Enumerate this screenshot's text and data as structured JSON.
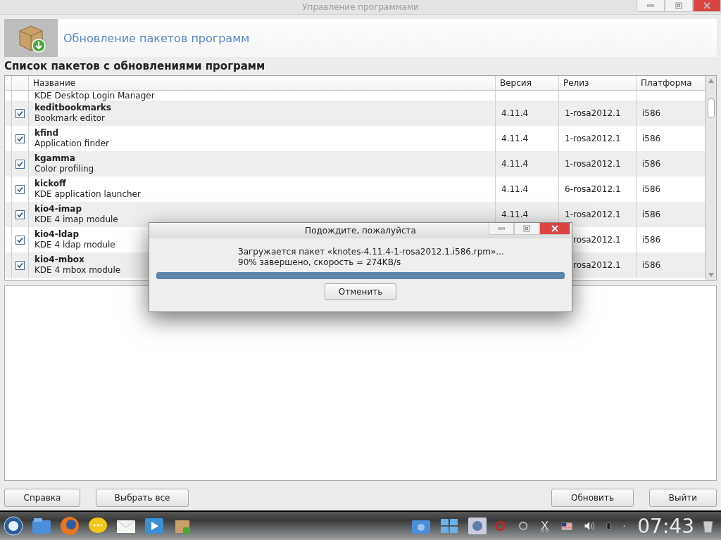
{
  "window": {
    "title": "Управление программами"
  },
  "header": {
    "title": "Обновление пакетов программ"
  },
  "section_title": "Список пакетов с обновлениями программ",
  "table": {
    "columns": [
      "Название",
      "Версия",
      "Релиз",
      "Платформа"
    ],
    "rows": [
      {
        "description": "KDE Desktop Login Manager",
        "kind": "partial"
      },
      {
        "name": "keditbookmarks",
        "description": "Bookmark editor",
        "version": "4.11.4",
        "release": "1-rosa2012.1",
        "platform": "i586",
        "kind": "full",
        "checked": true,
        "covered": false
      },
      {
        "name": "kfind",
        "description": "Application finder",
        "version": "4.11.4",
        "release": "1-rosa2012.1",
        "platform": "i586",
        "kind": "full",
        "checked": true,
        "covered": false
      },
      {
        "name": "kgamma",
        "description": "Color profiling",
        "version": "4.11.4",
        "release": "1-rosa2012.1",
        "platform": "i586",
        "kind": "full",
        "checked": true,
        "covered": false
      },
      {
        "name": "kickoff",
        "description": "KDE application launcher",
        "version": "4.11.4",
        "release": "6-rosa2012.1",
        "platform": "i586",
        "kind": "full",
        "checked": true,
        "covered": false
      },
      {
        "name": "kio4-imap",
        "description": "KDE 4 imap module",
        "version": "4.11.4",
        "release": "1-rosa2012.1",
        "platform": "i586",
        "kind": "full",
        "checked": true,
        "covered": false
      },
      {
        "name": "kio4-ldap",
        "description": "KDE 4 ldap module",
        "release": "rosa2012.1",
        "platform": "i586",
        "kind": "full",
        "checked": true,
        "covered": true
      },
      {
        "name": "kio4-mbox",
        "description": "KDE 4 mbox module",
        "release": "rosa2012.1",
        "platform": "i586",
        "kind": "full",
        "checked": true,
        "covered": true
      }
    ]
  },
  "buttons_left": [
    "Справка",
    "Выбрать все"
  ],
  "buttons_right": [
    "Обновить",
    "Выйти"
  ],
  "dialog": {
    "title": "Подождите, пожалуйста",
    "message": "Загружается пакет «knotes-4.11.4-1-rosa2012.1.i586.rpm»...",
    "progress_text": "90% завершено, скорость = 274KB/s",
    "level": 1,
    "button": "Отменить"
  },
  "taskbar": {
    "clock": "07:43"
  }
}
